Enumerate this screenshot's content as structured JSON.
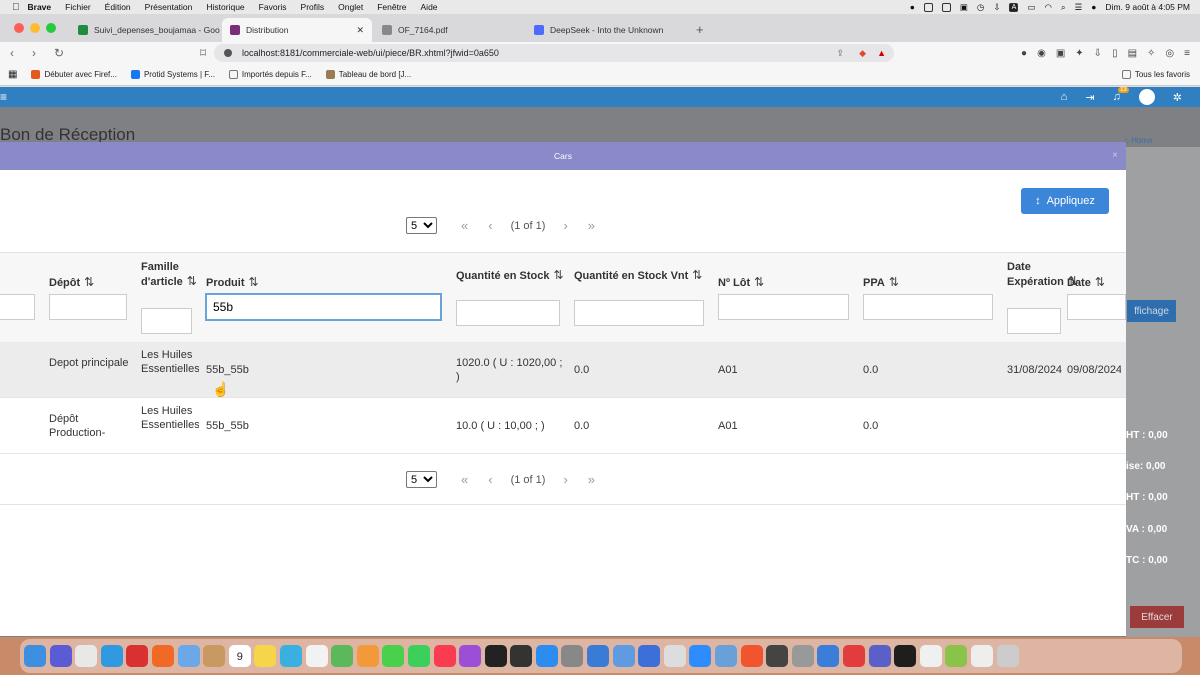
{
  "menubar": {
    "apple": "",
    "app": "Brave",
    "items": [
      "Fichier",
      "Édition",
      "Présentation",
      "Historique",
      "Favoris",
      "Profils",
      "Onglet",
      "Fenêtre",
      "Aide"
    ],
    "clock": "Dim. 9 août à 4:05 PM",
    "keyboard": "A"
  },
  "tabs": [
    {
      "title": "Suivi_depenses_boujamaa - Goog",
      "color": "#1e8e3e"
    },
    {
      "title": "Distribution",
      "color": "#7b2d7b"
    },
    {
      "title": "OF_7164.pdf",
      "color": "#888888"
    },
    {
      "title": "DeepSeek - Into the Unknown",
      "color": "#4d6bfe"
    }
  ],
  "tab_plus": "+",
  "tab_close": "✕",
  "address": {
    "url": "localhost:8181/commerciale-web/ui/piece/BR.xhtml?jfwid=0a650"
  },
  "bookmarks": [
    {
      "label": "Débuter avec Firef...",
      "color": "#e25a1c"
    },
    {
      "label": "Protid Systems | F...",
      "color": "#1877f2"
    },
    {
      "label": "Importés depuis F...",
      "color": "#777777"
    },
    {
      "label": "Tableau de bord [J...",
      "color": "#9b7b52"
    }
  ],
  "bookmarks_right": "Tous les favoris",
  "app": {
    "badge": "13",
    "menu_glyph": "≡"
  },
  "page": {
    "title": "Bon de Réception",
    "breadcrumb": "Home",
    "bg_button": "ffichage",
    "totals": [
      "HT : 0,00",
      "ise: 0,00",
      "HT : 0,00",
      "VA : 0,00",
      "TC : 0,00"
    ],
    "clear_button": "Effacer"
  },
  "modal": {
    "title": "Cars",
    "close": "×",
    "apply_label": "Appliquez",
    "apply_icon": "↕",
    "pager": {
      "rows_per_page": "5",
      "page_report": "(1 of 1)",
      "first": "«",
      "prev": "‹",
      "next": "›",
      "last": "»"
    },
    "sort_glyph": "⇅",
    "columns": {
      "depot": "Dépôt",
      "famille": "Famille d'article",
      "produit": "Produit",
      "qte_stock": "Quantité en Stock",
      "qte_stock_vnt": "Quantité en Stock Vnt",
      "lot": "Nº Lôt",
      "ppa": "PPA",
      "date_exp": "Date Expération",
      "date": "Date"
    },
    "filters": {
      "produit": "55b"
    },
    "rows": [
      {
        "depot": "Depot principale",
        "famille": "Les Huiles Essentielles",
        "produit": "55b_55b",
        "qte_stock": "1020.0 ( U : 1020,00 ; )",
        "qte_stock_vnt": "0.0",
        "lot": "A01",
        "ppa": "0.0",
        "date_exp": "31/08/2024",
        "date": "09/08/2024"
      },
      {
        "depot": "Dépôt Production-",
        "famille": "Les Huiles Essentielles",
        "produit": "55b_55b",
        "qte_stock": "10.0 ( U : 10,00 ; )",
        "qte_stock_vnt": "0.0",
        "lot": "A01",
        "ppa": "0.0",
        "date_exp": "",
        "date": ""
      }
    ]
  },
  "dock": {
    "items": [
      "finder",
      "siri",
      "launchpad",
      "safari",
      "opera",
      "firefox",
      "mail",
      "contacts",
      "calendar",
      "notes",
      "freeform",
      "reminders",
      "maps",
      "photos",
      "messages",
      "facetime",
      "music",
      "podcasts",
      "tv",
      "terminal",
      "appstore",
      "settings",
      "vpn",
      "preview",
      "keynote",
      "help",
      "zoom",
      "browser",
      "brave",
      "camera",
      "calculator",
      "network",
      "anydesk",
      "teams",
      "terminal2",
      "inkscape",
      "android",
      "downloads",
      "trash"
    ],
    "calendar_day": "9"
  }
}
